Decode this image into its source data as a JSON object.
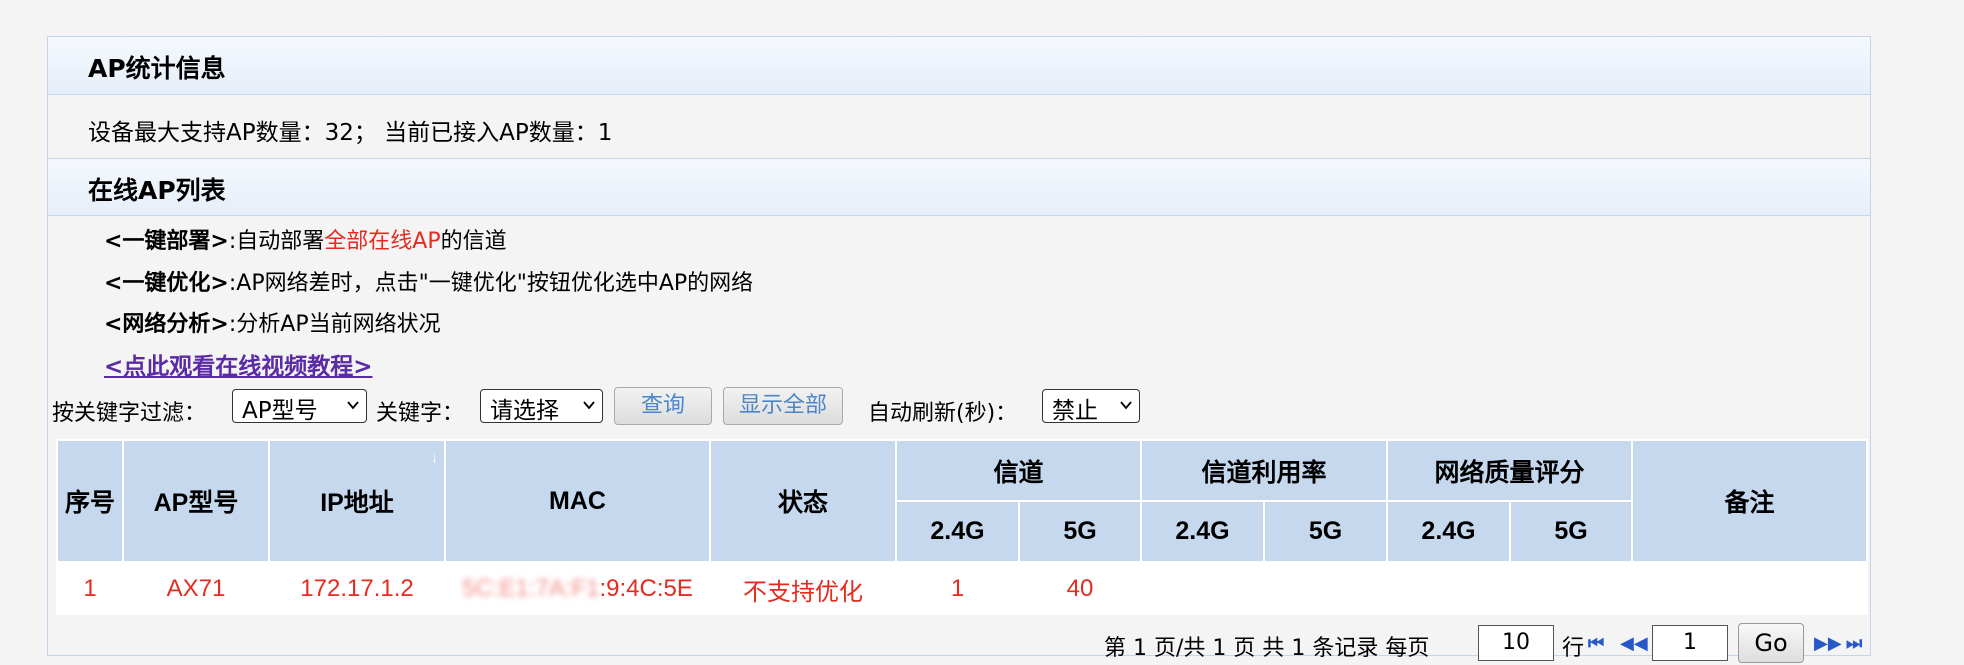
{
  "ap_stats": {
    "title": "AP统计信息",
    "summary": "设备最大支持AP数量：32；  当前已接入AP数量：1"
  },
  "online_list": {
    "title": "在线AP列表",
    "notes": [
      {
        "key": "<一键部署>",
        "text_before": ":自动部署",
        "highlight": "全部在线AP",
        "text_after": "的信道"
      },
      {
        "key": "<一键优化>",
        "text_before": ":AP网络差时，点击\"一键优化\"按钮优化选中AP的网络",
        "highlight": "",
        "text_after": ""
      },
      {
        "key": "<网络分析>",
        "text_before": ":分析AP当前网络状况",
        "highlight": "",
        "text_after": ""
      }
    ],
    "video_link": "<点此观看在线视频教程>"
  },
  "filter": {
    "filter_label": "按关键字过滤：",
    "filter_select": "AP型号",
    "keyword_label": "关键字：",
    "keyword_select": "请选择",
    "query_button": "查询",
    "show_all_button": "显示全部",
    "refresh_label": "自动刷新(秒)：",
    "refresh_select": "禁止"
  },
  "table": {
    "headers": {
      "index": "序号",
      "model": "AP型号",
      "ip": "IP地址",
      "mac": "MAC",
      "status": "状态",
      "channel": "信道",
      "channel_util": "信道利用率",
      "quality": "网络质量评分",
      "remark": "备注",
      "band_24": "2.4G",
      "band_5": "5G"
    },
    "rows": [
      {
        "index": "1",
        "model": "AX71",
        "ip": "172.17.1.2",
        "mac_hidden": "5C:E1:7A:F1",
        "mac_visible": ":9:4C:5E",
        "status": "不支持优化",
        "channel_24": "1",
        "channel_5": "40",
        "util_24": "",
        "util_5": "",
        "quality_24": "",
        "quality_5": "",
        "remark": ""
      }
    ]
  },
  "pager": {
    "page_text": "第 1 页/共 1 页 共 1 条记录 每页",
    "per_page": "10",
    "row_unit": "行",
    "page_input": "1",
    "go_button": "Go"
  },
  "colors": {
    "accent_red": "#e62b1e",
    "header_blue": "#c5d8ee",
    "link_purple": "#5b2aa5"
  }
}
